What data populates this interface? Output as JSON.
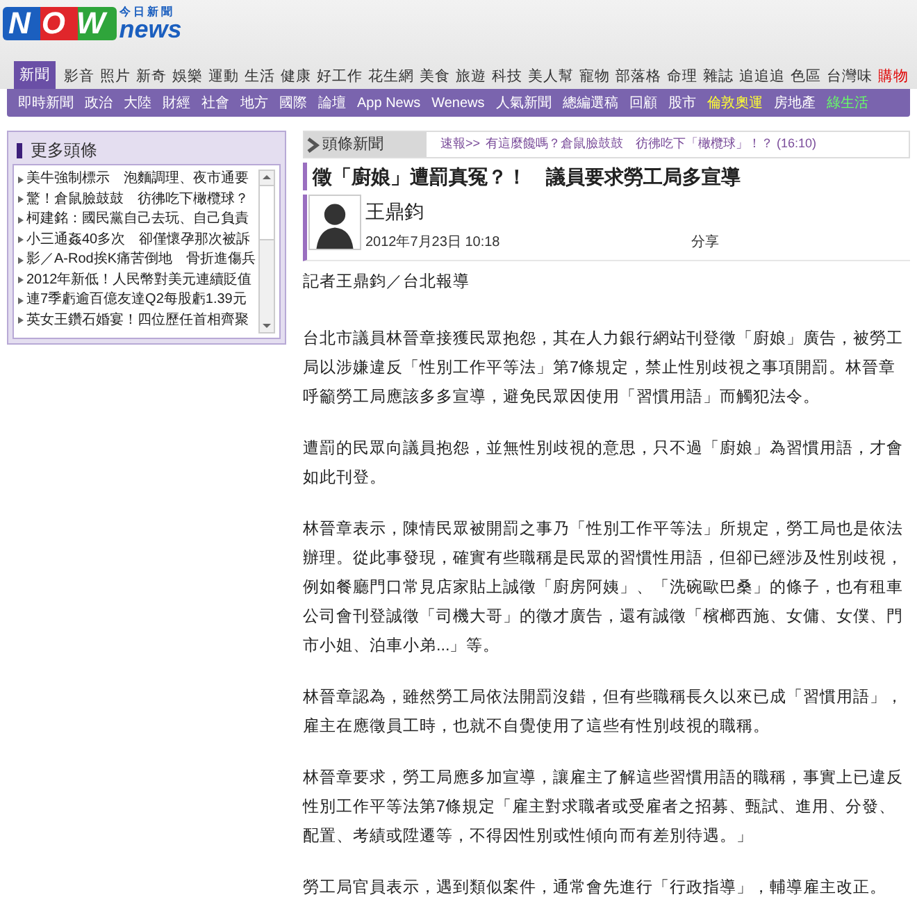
{
  "logo": {
    "brand": "NOW",
    "suffix": "news",
    "tagline": "今日新聞"
  },
  "main_nav": [
    {
      "label": "新聞",
      "selected": true
    },
    {
      "label": "影音",
      "selected": false,
      "color": "#333333"
    },
    {
      "label": "照片",
      "selected": false,
      "color": "#333333"
    },
    {
      "label": "新奇",
      "selected": false,
      "color": "#333333"
    },
    {
      "label": "娛樂",
      "selected": false,
      "color": "#333333"
    },
    {
      "label": "運動",
      "selected": false,
      "color": "#333333"
    },
    {
      "label": "生活",
      "selected": false,
      "color": "#333333"
    },
    {
      "label": "健康",
      "selected": false,
      "color": "#333333"
    },
    {
      "label": "好工作",
      "selected": false,
      "color": "#333333"
    },
    {
      "label": "花生網",
      "selected": false,
      "color": "#333333"
    },
    {
      "label": "美食",
      "selected": false,
      "color": "#333333"
    },
    {
      "label": "旅遊",
      "selected": false,
      "color": "#333333"
    },
    {
      "label": "科技",
      "selected": false,
      "color": "#333333"
    },
    {
      "label": "美人幫",
      "selected": false,
      "color": "#333333"
    },
    {
      "label": "寵物",
      "selected": false,
      "color": "#333333"
    },
    {
      "label": "部落格",
      "selected": false,
      "color": "#333333"
    },
    {
      "label": "命理",
      "selected": false,
      "color": "#333333"
    },
    {
      "label": "雜誌",
      "selected": false,
      "color": "#333333"
    },
    {
      "label": "追追追",
      "selected": false,
      "color": "#333333"
    },
    {
      "label": "色區",
      "selected": false,
      "color": "#333333"
    },
    {
      "label": "台灣味",
      "selected": false,
      "color": "#333333"
    },
    {
      "label": "購物",
      "selected": false,
      "color": "#e00000"
    }
  ],
  "sub_nav": [
    {
      "label": "即時新聞",
      "color": "#ffffff"
    },
    {
      "label": "政治",
      "color": "#ffffff"
    },
    {
      "label": "大陸",
      "color": "#ffffff"
    },
    {
      "label": "財經",
      "color": "#ffffff"
    },
    {
      "label": "社會",
      "color": "#ffffff"
    },
    {
      "label": "地方",
      "color": "#ffffff"
    },
    {
      "label": "國際",
      "color": "#ffffff"
    },
    {
      "label": "論壇",
      "color": "#ffffff"
    },
    {
      "label": "App News",
      "color": "#ffffff"
    },
    {
      "label": "Wenews",
      "color": "#ffffff"
    },
    {
      "label": "人氣新聞",
      "color": "#ffffff"
    },
    {
      "label": "總編選稿",
      "color": "#ffffff"
    },
    {
      "label": "回顧",
      "color": "#ffffff"
    },
    {
      "label": "股市",
      "color": "#ffffff"
    },
    {
      "label": "倫敦奧運",
      "color": "#ffff33"
    },
    {
      "label": "房地產",
      "color": "#ffffff"
    },
    {
      "label": "綠生活",
      "color": "#66ff66"
    }
  ],
  "sidebar": {
    "title": "更多頭條",
    "items": [
      "美牛強制標示　泡麵調理、夜市通要",
      "驚！倉鼠臉鼓鼓　彷彿吃下橄欖球？",
      "柯建銘：國民黨自己去玩、自己負責",
      "小三通姦40多次　卻僅懷孕那次被訴",
      "影／A-Rod挨K痛苦倒地　骨折進傷兵",
      "2012年新低！人民幣對美元連續貶值",
      "連7季虧逾百億友達Q2每股虧1.39元",
      "英女王鑽石婚宴！四位歷任首相齊聚"
    ]
  },
  "section": {
    "label": "頭條新聞",
    "ticker_prefix": "速報>>",
    "ticker_text": "有這麼饞嗎？倉鼠臉鼓鼓　彷彿吃下「橄欖球」！？ (16:10)"
  },
  "article": {
    "title": "徵「廚娘」遭罰真冤？！　議員要求勞工局多宣導",
    "author": "王鼎鈞",
    "date": "2012年7月23日 10:18",
    "share": "分享",
    "byline": "記者王鼎鈞／台北報導",
    "paragraphs": [
      "台北市議員林晉章接獲民眾抱怨，其在人力銀行網站刊登徵「廚娘」廣告，被勞工局以涉嫌違反「性別工作平等法」第7條規定，禁止性別歧視之事項開罰。林晉章呼籲勞工局應該多多宣導，避免民眾因使用「習慣用語」而觸犯法令。",
      "遭罰的民眾向議員抱怨，並無性別歧視的意思，只不過「廚娘」為習慣用語，才會如此刊登。",
      "林晉章表示，陳情民眾被開罰之事乃「性別工作平等法」所規定，勞工局也是依法辦理。從此事發現，確實有些職稱是民眾的習慣性用語，但卻已經涉及性別歧視，例如餐廳門口常見店家貼上誠徵「廚房阿姨」、「洗碗歐巴桑」的條子，也有租車公司會刊登誠徵「司機大哥」的徵才廣告，還有誠徵「檳榔西施、女傭、女僕、門市小姐、泊車小弟...」等。",
      "林晉章認為，雖然勞工局依法開罰沒錯，但有些職稱長久以來已成「習慣用語」，雇主在應徵員工時，也就不自覺使用了這些有性別歧視的職稱。",
      "林晉章要求，勞工局應多加宣導，讓雇主了解這些習慣用語的職稱，事實上已違反性別工作平等法第7條規定「雇主對求職者或受雇者之招募、甄試、進用、分發、配置、考績或陞遷等，不得因性別或性傾向而有差別待遇。」",
      "勞工局官員表示，遇到類似案件，通常會先進行「行政指導」，輔導雇主改正。"
    ]
  }
}
